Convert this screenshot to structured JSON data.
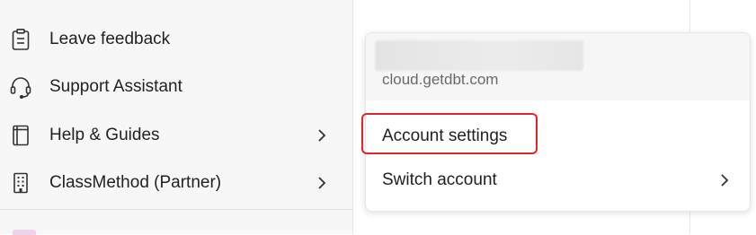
{
  "sidebar": {
    "items": [
      {
        "label": "Leave feedback",
        "icon": "clipboard-icon",
        "has_submenu": false
      },
      {
        "label": "Support Assistant",
        "icon": "headset-icon",
        "has_submenu": false
      },
      {
        "label": "Help & Guides",
        "icon": "book-icon",
        "has_submenu": true
      },
      {
        "label": "ClassMethod (Partner)",
        "icon": "building-icon",
        "has_submenu": true
      }
    ]
  },
  "account_menu": {
    "host": "cloud.getdbt.com",
    "items": [
      {
        "label": "Account settings",
        "has_submenu": false,
        "highlighted": true
      },
      {
        "label": "Switch account",
        "has_submenu": true,
        "highlighted": false
      }
    ]
  },
  "colors": {
    "highlight_outline": "#e0262b",
    "sidebar_background": "#f7f7f7",
    "panel_header_background": "#f6f6f6"
  }
}
